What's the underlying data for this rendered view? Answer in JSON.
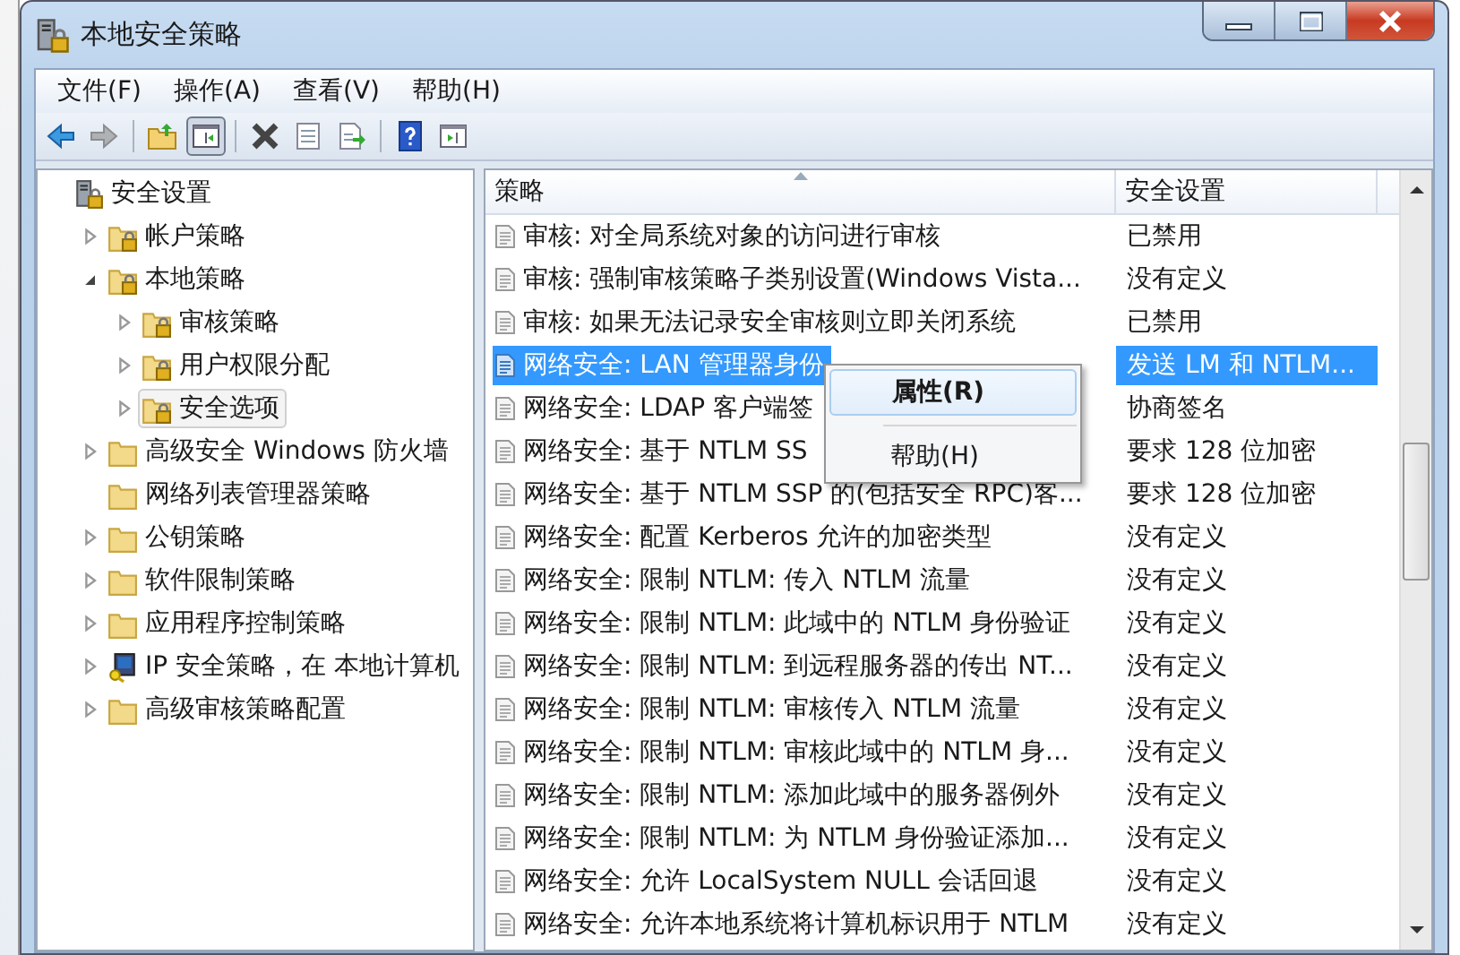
{
  "window": {
    "title": "本地安全策略"
  },
  "menu": [
    "文件(F)",
    "操作(A)",
    "查看(V)",
    "帮助(H)"
  ],
  "toolbar": [
    {
      "kind": "back",
      "disabled": false,
      "pressed": false
    },
    {
      "kind": "forward",
      "disabled": true,
      "pressed": false
    },
    {
      "kind": "sep"
    },
    {
      "kind": "up",
      "disabled": false,
      "pressed": false
    },
    {
      "kind": "tree",
      "disabled": false,
      "pressed": true
    },
    {
      "kind": "sep"
    },
    {
      "kind": "delete",
      "disabled": false,
      "pressed": false
    },
    {
      "kind": "properties",
      "disabled": false,
      "pressed": false
    },
    {
      "kind": "export",
      "disabled": false,
      "pressed": false
    },
    {
      "kind": "sep"
    },
    {
      "kind": "help",
      "disabled": false,
      "pressed": false
    },
    {
      "kind": "view",
      "disabled": false,
      "pressed": false
    }
  ],
  "tree": [
    {
      "label": "安全设置",
      "kind": "root",
      "selected": false,
      "children": [
        {
          "label": "帐户策略",
          "kind": "lockfolder",
          "selected": false,
          "expanded": false
        },
        {
          "label": "本地策略",
          "kind": "lockfolder",
          "selected": false,
          "expanded": true,
          "children": [
            {
              "label": "审核策略",
              "kind": "lockfolder",
              "selected": false,
              "expanded": false
            },
            {
              "label": "用户权限分配",
              "kind": "lockfolder",
              "selected": false,
              "expanded": false
            },
            {
              "label": "安全选项",
              "kind": "lockfolder",
              "selected": true,
              "expanded": false
            }
          ]
        },
        {
          "label": "高级安全 Windows 防火墙",
          "kind": "folder",
          "selected": false,
          "expanded": false
        },
        {
          "label": "网络列表管理器策略",
          "kind": "folder",
          "selected": false
        },
        {
          "label": "公钥策略",
          "kind": "folder",
          "selected": false,
          "expanded": false
        },
        {
          "label": "软件限制策略",
          "kind": "folder",
          "selected": false,
          "expanded": false
        },
        {
          "label": "应用程序控制策略",
          "kind": "folder",
          "selected": false,
          "expanded": false
        },
        {
          "label": "IP 安全策略，在 本地计算机",
          "kind": "ipsec",
          "selected": false,
          "expanded": false
        },
        {
          "label": "高级审核策略配置",
          "kind": "folder",
          "selected": false,
          "expanded": false
        }
      ]
    }
  ],
  "table": {
    "columns": [
      {
        "label": "策略",
        "sorted": true
      },
      {
        "label": "安全设置",
        "sorted": false
      }
    ],
    "rows": [
      {
        "policy": "审核: 对全局系统对象的访问进行审核",
        "setting": "已禁用",
        "selected": false
      },
      {
        "policy": "审核: 强制审核策略子类别设置(Windows Vista...",
        "setting": "没有定义",
        "selected": false
      },
      {
        "policy": "审核: 如果无法记录安全审核则立即关闭系统",
        "setting": "已禁用",
        "selected": false
      },
      {
        "policy": "网络安全: LAN 管理器身份",
        "setting": "发送 LM 和 NTLM...",
        "selected": true
      },
      {
        "policy": "网络安全: LDAP 客户端签",
        "setting": "协商签名",
        "selected": false
      },
      {
        "policy": "网络安全: 基于 NTLM SS",
        "setting": "要求 128 位加密",
        "selected": false
      },
      {
        "policy": "网络安全: 基于 NTLM SSP 的(包括安全 RPC)客...",
        "setting": "要求 128 位加密",
        "selected": false
      },
      {
        "policy": "网络安全: 配置 Kerberos 允许的加密类型",
        "setting": "没有定义",
        "selected": false
      },
      {
        "policy": "网络安全: 限制 NTLM: 传入 NTLM 流量",
        "setting": "没有定义",
        "selected": false
      },
      {
        "policy": "网络安全: 限制 NTLM: 此域中的 NTLM 身份验证",
        "setting": "没有定义",
        "selected": false
      },
      {
        "policy": "网络安全: 限制 NTLM: 到远程服务器的传出 NT...",
        "setting": "没有定义",
        "selected": false
      },
      {
        "policy": "网络安全: 限制 NTLM: 审核传入 NTLM 流量",
        "setting": "没有定义",
        "selected": false
      },
      {
        "policy": "网络安全: 限制 NTLM: 审核此域中的 NTLM 身...",
        "setting": "没有定义",
        "selected": false
      },
      {
        "policy": "网络安全: 限制 NTLM: 添加此域中的服务器例外",
        "setting": "没有定义",
        "selected": false
      },
      {
        "policy": "网络安全: 限制 NTLM: 为 NTLM 身份验证添加...",
        "setting": "没有定义",
        "selected": false
      },
      {
        "policy": "网络安全: 允许 LocalSystem NULL 会话回退",
        "setting": "没有定义",
        "selected": false
      },
      {
        "policy": "网络安全: 允许本地系统将计算机标识用于 NTLM",
        "setting": "没有定义",
        "selected": false
      }
    ]
  },
  "context_menu": [
    {
      "label": "属性(R)",
      "default": true
    },
    {
      "kind": "sep"
    },
    {
      "label": "帮助(H)",
      "default": false
    }
  ]
}
